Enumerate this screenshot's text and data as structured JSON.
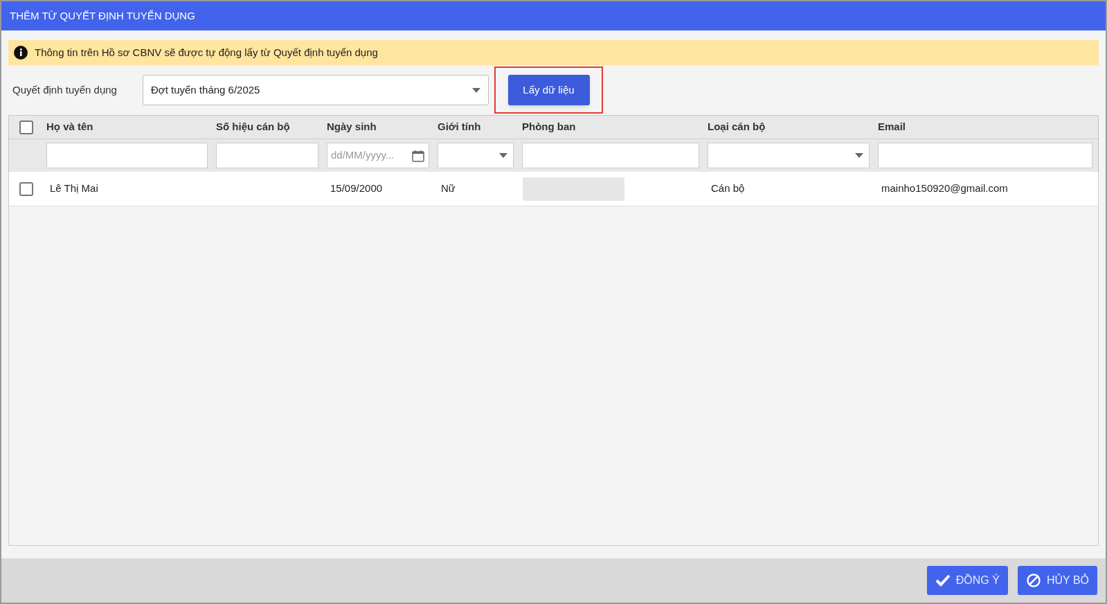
{
  "window": {
    "title": "THÊM TỪ QUYẾT ĐỊNH TUYỂN DỤNG"
  },
  "notice": "Thông tin trên Hồ sơ CBNV sẽ được tự động lấy từ Quyết định tuyển dụng",
  "decision": {
    "label": "Quyết định tuyển dụng",
    "value": "Đợt tuyển tháng 6/2025"
  },
  "fetch_button": {
    "label": "Lấy dữ liệu",
    "highlighted": true
  },
  "table": {
    "select_all": {
      "checked": false
    },
    "columns": [
      {
        "label": "Họ và tên",
        "filter": {
          "kind": "text"
        }
      },
      {
        "label": "Số hiệu cán bộ",
        "filter": {
          "kind": "text"
        }
      },
      {
        "label": "Ngày sinh",
        "filter": {
          "kind": "date",
          "placeholder": "dd/MM/yyyy..."
        }
      },
      {
        "label": "Giới tính",
        "filter": {
          "kind": "select"
        }
      },
      {
        "label": "Phòng ban",
        "filter": {
          "kind": "text"
        }
      },
      {
        "label": "Loại cán bộ",
        "filter": {
          "kind": "select"
        }
      },
      {
        "label": "Email",
        "filter": {
          "kind": "text"
        }
      }
    ],
    "rows": [
      {
        "checked": false,
        "cells": [
          {
            "kind": "text",
            "text": "Lê Thị Mai"
          },
          {
            "kind": "empty"
          },
          {
            "kind": "text",
            "text": "15/09/2000"
          },
          {
            "kind": "text",
            "text": "Nữ"
          },
          {
            "kind": "blurred"
          },
          {
            "kind": "text",
            "text": "Cán bộ"
          },
          {
            "kind": "text",
            "text": "mainho150920@gmail.com"
          }
        ]
      }
    ]
  },
  "buttons": [
    {
      "kind": "confirm",
      "label": "ĐỒNG Ý"
    },
    {
      "kind": "cancel",
      "label": "HỦY BỎ"
    }
  ]
}
